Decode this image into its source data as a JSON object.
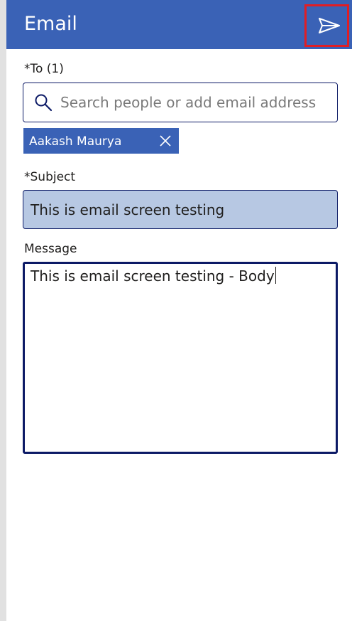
{
  "header": {
    "title": "Email",
    "send_icon": "send-icon"
  },
  "to": {
    "label": "*To (1)",
    "search_placeholder": "Search people or add email address",
    "search_icon": "search-icon",
    "recipients": [
      {
        "name": "Aakash Maurya",
        "remove_icon": "close-icon"
      }
    ]
  },
  "subject": {
    "label": "*Subject",
    "value": "This is email screen testing"
  },
  "message": {
    "label": "Message",
    "value": "This is email screen testing - Body"
  },
  "colors": {
    "header_bg": "#3a62b6",
    "chip_bg": "#3a62b6",
    "subject_bg": "#b7c8e3",
    "border": "#0c1a66",
    "highlight": "#e01e25"
  }
}
